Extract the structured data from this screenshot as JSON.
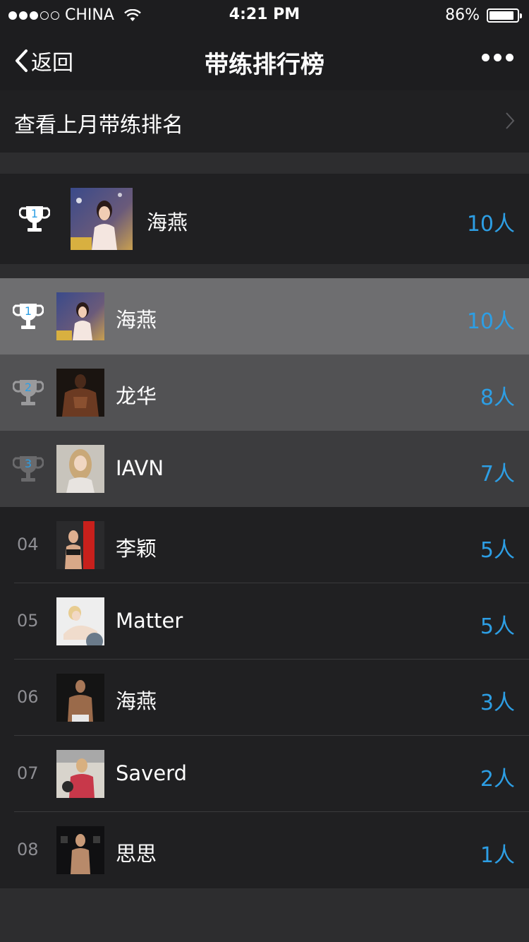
{
  "status_bar": {
    "carrier": "CHINA",
    "time": "4:21 PM",
    "battery": "86%",
    "signal_dots_filled": 3,
    "signal_dots_total": 5
  },
  "nav": {
    "back_label": "返回",
    "title": "带练排行榜"
  },
  "last_month": {
    "label": "查看上月带练排名"
  },
  "my_rank": {
    "rank": "1",
    "name": "海燕",
    "count": "10人"
  },
  "colors": {
    "accent": "#2d9ee4",
    "rank1_bg": "#6e6e70",
    "rank2_bg": "#525254",
    "rank3_bg": "#3c3c3e",
    "list_bg": "#202022"
  },
  "ranking": [
    {
      "rank": "1",
      "name": "海燕",
      "count": "10人",
      "icon": "trophy-icon"
    },
    {
      "rank": "2",
      "name": "龙华",
      "count": "8人",
      "icon": "trophy-icon"
    },
    {
      "rank": "3",
      "name": "IAVN",
      "count": "7人",
      "icon": "trophy-icon"
    },
    {
      "rank": "04",
      "name": "李颖",
      "count": "5人"
    },
    {
      "rank": "05",
      "name": "Matter",
      "count": "5人"
    },
    {
      "rank": "06",
      "name": "海燕",
      "count": "3人"
    },
    {
      "rank": "07",
      "name": "Saverd",
      "count": "2人"
    },
    {
      "rank": "08",
      "name": "思思",
      "count": "1人"
    }
  ]
}
